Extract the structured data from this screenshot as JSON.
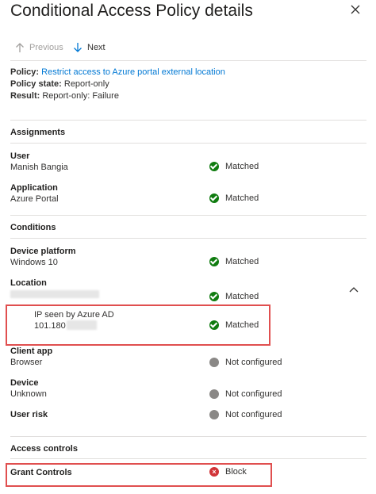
{
  "header": {
    "title": "Conditional Access Policy details",
    "prev_label": "Previous",
    "next_label": "Next"
  },
  "policy": {
    "policy_label": "Policy:",
    "policy_value": "Restrict access to Azure portal external location",
    "state_label": "Policy state:",
    "state_value": "Report-only",
    "result_label": "Result:",
    "result_value": "Report-only: Failure"
  },
  "assignments": {
    "heading": "Assignments",
    "user": {
      "label": "User",
      "value": "Manish Bangia",
      "status": "Matched"
    },
    "application": {
      "label": "Application",
      "value": "Azure Portal",
      "status": "Matched"
    }
  },
  "conditions": {
    "heading": "Conditions",
    "device_platform": {
      "label": "Device platform",
      "value": "Windows 10",
      "status": "Matched"
    },
    "location": {
      "label": "Location",
      "status": "Matched",
      "ip_label": "IP seen by Azure AD",
      "ip_value": "101.180",
      "ip_status": "Matched"
    },
    "client_app": {
      "label": "Client app",
      "value": "Browser",
      "status": "Not configured"
    },
    "device": {
      "label": "Device",
      "value": "Unknown",
      "status": "Not configured"
    },
    "user_risk": {
      "label": "User risk",
      "status": "Not configured"
    }
  },
  "access_controls": {
    "heading": "Access controls",
    "grant": {
      "label": "Grant Controls",
      "status": "Block"
    }
  },
  "colors": {
    "link": "#0078d4",
    "matched": "#107c10",
    "not_configured": "#8a8886",
    "block": "#d13438",
    "highlight": "#e04f4f"
  }
}
